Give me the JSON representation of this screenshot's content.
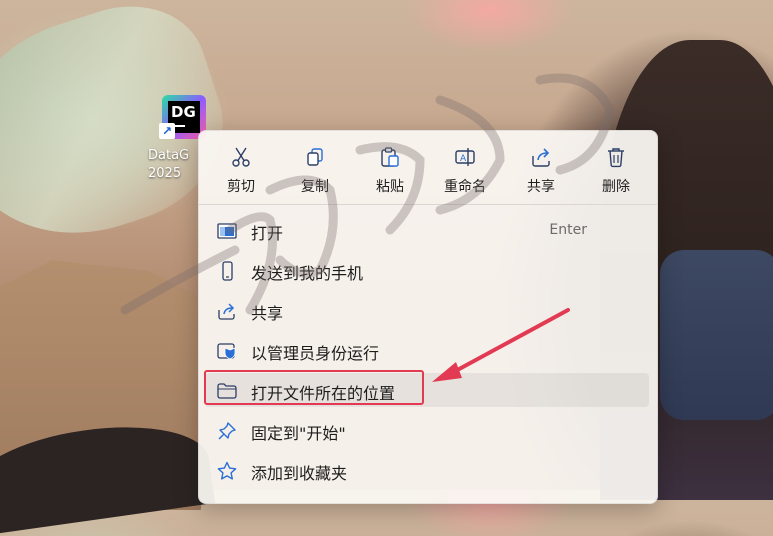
{
  "desktop": {
    "icon_caption_line1": "DataG",
    "icon_caption_line2": "2025",
    "logo_text": "DG"
  },
  "menu": {
    "quick_actions": [
      {
        "label": "剪切",
        "icon": "scissors-icon"
      },
      {
        "label": "复制",
        "icon": "copy-icon"
      },
      {
        "label": "粘贴",
        "icon": "paste-icon"
      },
      {
        "label": "重命名",
        "icon": "rename-icon"
      },
      {
        "label": "共享",
        "icon": "share-icon"
      },
      {
        "label": "删除",
        "icon": "trash-icon"
      }
    ],
    "items": [
      {
        "label": "打开",
        "shortcut": "Enter",
        "icon": "open-window-icon"
      },
      {
        "label": "发送到我的手机",
        "icon": "phone-icon"
      },
      {
        "label": "共享",
        "icon": "share-icon"
      },
      {
        "label": "以管理员身份运行",
        "icon": "admin-shield-icon"
      },
      {
        "label": "打开文件所在的位置",
        "icon": "folder-icon"
      },
      {
        "label": "固定到\"开始\"",
        "icon": "pin-icon"
      },
      {
        "label": "添加到收藏夹",
        "icon": "star-icon"
      }
    ]
  },
  "annotation": {
    "color": "#e23a52"
  }
}
